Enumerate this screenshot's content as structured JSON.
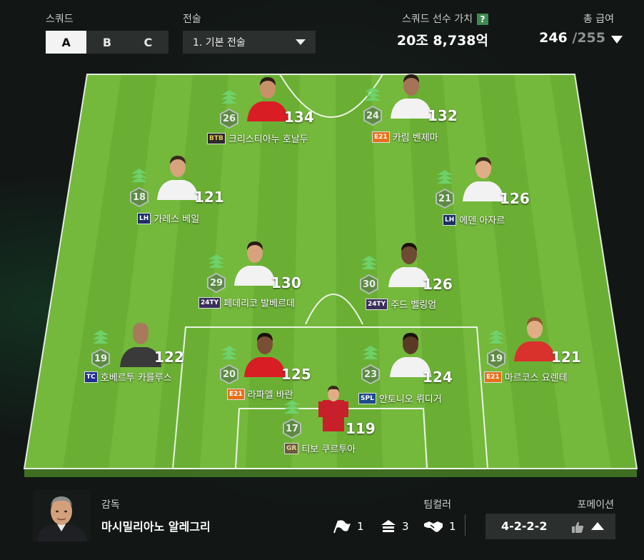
{
  "header": {
    "squad_label": "스쿼드",
    "squad_tabs": [
      "A",
      "B",
      "C"
    ],
    "squad_selected": "A",
    "tactic_label": "전술",
    "tactic_value": "1. 기본 전술",
    "value_label": "스쿼드 선수 가치",
    "value_help": "?",
    "value_amount": "20조 8,738억",
    "salary_label": "총 급여",
    "salary_used": "246",
    "salary_cap": "/255"
  },
  "players": [
    {
      "id": "ronaldo",
      "name": "크리스티아누 호날두",
      "badge": "BTB",
      "ovr": "134",
      "level": "26",
      "badge_color": "#2b2b2b",
      "badge_fg": "#e8c35a",
      "shirt": "#d81d24",
      "skin": "#c7926a",
      "hair": "#2a1c12"
    },
    {
      "id": "benzema",
      "name": "카림 벤제마",
      "badge": "E21",
      "ovr": "132",
      "level": "24",
      "badge_color": "#e8701a",
      "badge_fg": "#fff",
      "shirt": "#f2f2f2",
      "skin": "#a57356",
      "hair": "#2a1c12"
    },
    {
      "id": "bale",
      "name": "가레스 베일",
      "badge": "LH",
      "ovr": "121",
      "level": "18",
      "badge_color": "#1b2f66",
      "badge_fg": "#fff",
      "shirt": "#f2f2f2",
      "skin": "#d7a37d",
      "hair": "#3a2a1a"
    },
    {
      "id": "hazard",
      "name": "에덴 아자르",
      "badge": "LH",
      "ovr": "126",
      "level": "21",
      "badge_color": "#1b2f66",
      "badge_fg": "#fff",
      "shirt": "#f2f2f2",
      "skin": "#e0ad86",
      "hair": "#3a2a1a"
    },
    {
      "id": "valverde",
      "name": "페데리코 발베르데",
      "badge": "24TY",
      "ovr": "130",
      "level": "29",
      "badge_color": "#3a2f5a",
      "badge_fg": "#fff",
      "shirt": "#f2f2f2",
      "skin": "#d7a37d",
      "hair": "#2a1c12"
    },
    {
      "id": "bellingham",
      "name": "주드 벨링엄",
      "badge": "24TY",
      "ovr": "126",
      "level": "30",
      "badge_color": "#3a2f5a",
      "badge_fg": "#fff",
      "shirt": "#f2f2f2",
      "skin": "#6e4a34",
      "hair": "#1a1208"
    },
    {
      "id": "carlos",
      "name": "호베르투 카를루스",
      "badge": "TC",
      "ovr": "122",
      "level": "19",
      "badge_color": "#1f2e8e",
      "badge_fg": "#fff",
      "shirt": "#3a3a3a",
      "skin": "#a87a5c",
      "hair": "#a87a5c"
    },
    {
      "id": "varane",
      "name": "라파엘 바란",
      "badge": "E21",
      "ovr": "125",
      "level": "20",
      "badge_color": "#e8701a",
      "badge_fg": "#fff",
      "shirt": "#d81d24",
      "skin": "#7a4e35",
      "hair": "#1a1208"
    },
    {
      "id": "rudiger",
      "name": "안토니오 뤼디거",
      "badge": "SPL",
      "ovr": "124",
      "level": "23",
      "badge_color": "#1d4b8a",
      "badge_fg": "#fff",
      "shirt": "#f2f2f2",
      "skin": "#5a3a26",
      "hair": "#1a1208"
    },
    {
      "id": "llorente",
      "name": "마르코스 요렌테",
      "badge": "E21",
      "ovr": "121",
      "level": "19",
      "badge_color": "#e8701a",
      "badge_fg": "#fff",
      "shirt": "#d9322c",
      "skin": "#e0ad86",
      "hair": "#8a5a2a"
    },
    {
      "id": "courtois",
      "name": "티보 쿠르투아",
      "badge": "GR",
      "ovr": "119",
      "level": "17",
      "badge_color": "#6a5a3a",
      "badge_fg": "#e8d6a0",
      "shirt": "#c8202a",
      "skin": "#e0ad86",
      "hair": "#3a2a1a"
    }
  ],
  "bottom": {
    "coach_label": "감독",
    "coach_name": "마시밀리아노 알레그리",
    "teamcolor_label": "팀컬러",
    "teamcolor_items": [
      {
        "icon": "flag-icon",
        "value": "1"
      },
      {
        "icon": "stack-up-icon",
        "value": "3"
      },
      {
        "icon": "handshake-icon",
        "value": "1"
      }
    ],
    "formation_label": "포메이션",
    "formation_value": "4-2-2-2"
  },
  "colors": {
    "pitch_light": "#7dc042",
    "pitch_dark": "#6ab034",
    "accent_green": "#6fd46f"
  }
}
